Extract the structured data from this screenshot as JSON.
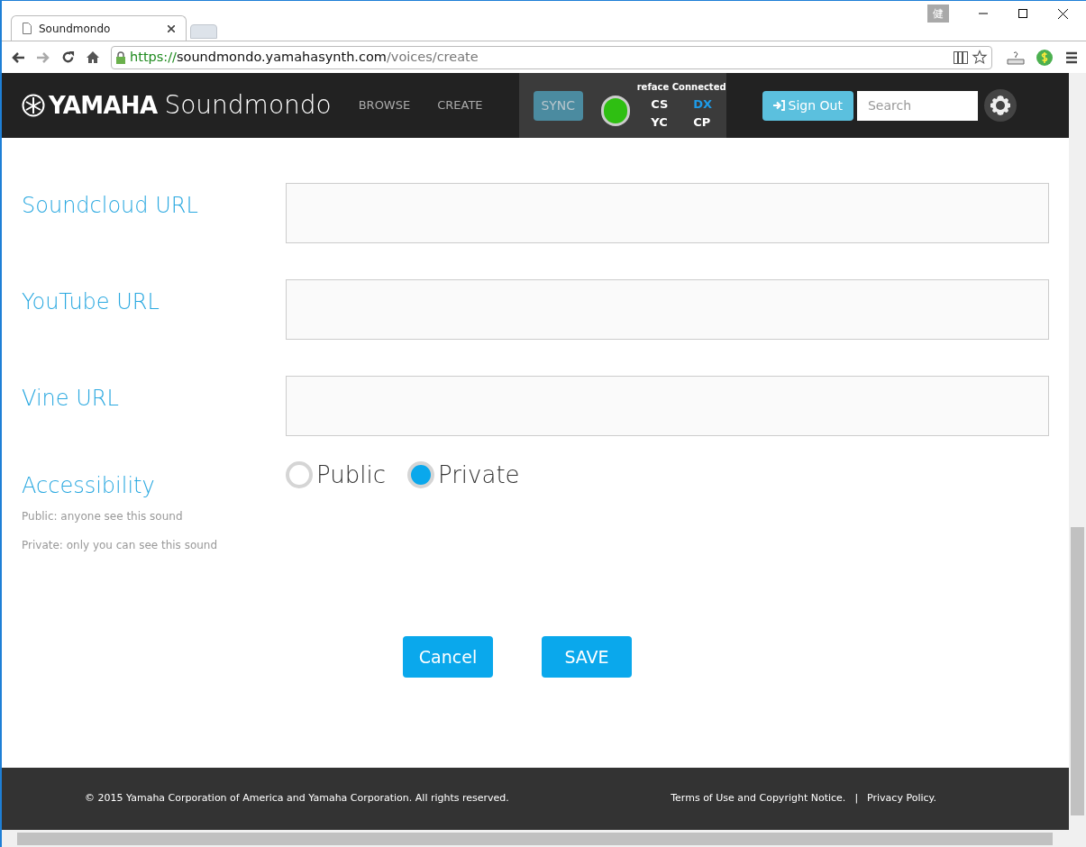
{
  "browser": {
    "tab_title": "Soundmondo",
    "ime_badge": "健",
    "url": {
      "scheme": "https://",
      "host": "soundmondo.yamahasynth.com",
      "path": "/voices/create"
    }
  },
  "header": {
    "brand": "YAMAHA",
    "product": "Soundmondo",
    "nav": [
      {
        "label": "BROWSE"
      },
      {
        "label": "CREATE"
      }
    ],
    "sync": "SYNC",
    "device_status": "reface Connected",
    "connected": true,
    "models": [
      {
        "label": "CS",
        "selected": false
      },
      {
        "label": "DX",
        "selected": true
      },
      {
        "label": "YC",
        "selected": false
      },
      {
        "label": "CP",
        "selected": false
      }
    ],
    "sign_out": "Sign Out",
    "search": {
      "placeholder": "Search"
    }
  },
  "form": {
    "fields": [
      {
        "label": "Soundcloud URL"
      },
      {
        "label": "YouTube URL"
      },
      {
        "label": "Vine URL"
      }
    ],
    "accessibility": {
      "label": "Accessibility",
      "notes": [
        "Public: anyone see this sound",
        "Private: only you can see this sound"
      ],
      "options": [
        {
          "label": "Public",
          "selected": false
        },
        {
          "label": "Private",
          "selected": true
        }
      ]
    },
    "buttons": [
      {
        "label": "Cancel"
      },
      {
        "label": "SAVE"
      }
    ]
  },
  "footer": {
    "copyright": "© 2015 Yamaha Corporation of America and Yamaha Corporation. All rights reserved.",
    "links": [
      "Terms of Use and Copyright Notice.",
      "Privacy Policy."
    ],
    "separator": "|"
  }
}
